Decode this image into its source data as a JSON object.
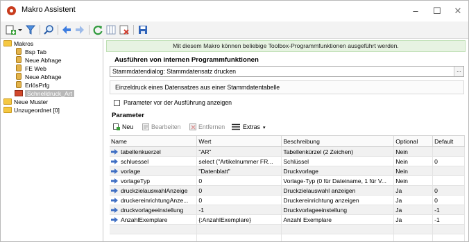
{
  "window": {
    "title": "Makro Assistent",
    "minimize": "–",
    "maximize": "☐",
    "close": "✕"
  },
  "toolbar": {
    "icons": [
      "add-icon",
      "funnel-icon",
      "search-icon",
      "back-icon",
      "forward-icon",
      "refresh-icon",
      "columns-icon",
      "delete-icon",
      "save-icon"
    ]
  },
  "tree": {
    "items": [
      {
        "label": "Makros",
        "type": "folder"
      },
      {
        "label": "Bsp Tab",
        "type": "doc"
      },
      {
        "label": "Neue Abfrage",
        "type": "doc"
      },
      {
        "label": "FE Web",
        "type": "doc"
      },
      {
        "label": "Neue Abfrage",
        "type": "doc"
      },
      {
        "label": "ErlösPrfg",
        "type": "doc"
      },
      {
        "label": "Schnelldruck_Art",
        "type": "macro"
      },
      {
        "label": "Neue Muster",
        "type": "folder"
      },
      {
        "label": "Unzugeordnet [0]",
        "type": "folder"
      }
    ]
  },
  "banner": "Mit diesem Makro können beliebige Toolbox-Programmfunktionen ausgeführt werden.",
  "section_exec": "Ausführen von internen Programmfunktionen",
  "function_combo": {
    "value": "Stammdatendialog: Stammdatensatz drucken",
    "button": "..."
  },
  "function_desc": "Einzeldruck eines Datensatzes aus einer Stammdatentabelle",
  "show_params_label": "Parameter vor der Ausführung anzeigen",
  "show_params_checked": false,
  "section_params": "Parameter",
  "grid_toolbar": {
    "new": "Neu",
    "edit": "Bearbeiten",
    "remove": "Entfernen",
    "extras": "Extras"
  },
  "grid": {
    "columns": [
      "Name",
      "Wert",
      "Beschreibung",
      "Optional",
      "Default"
    ],
    "rows": [
      {
        "name": "tabellenkuerzel",
        "wert": "\"AR\"",
        "beschreibung": "Tabellenkürzel (2 Zeichen)",
        "optional": "Nein",
        "default": ""
      },
      {
        "name": "schluessel",
        "wert": "select (\"Artikelnummer FR...",
        "beschreibung": "Schlüssel",
        "optional": "Nein",
        "default": "0"
      },
      {
        "name": "vorlage",
        "wert": "\"Datenblatt\"",
        "beschreibung": "Druckvorlage",
        "optional": "Nein",
        "default": ""
      },
      {
        "name": "vorlageTyp",
        "wert": "0",
        "beschreibung": "Vorlage-Typ (0 für Dateiname, 1 für V...",
        "optional": "Nein",
        "default": ""
      },
      {
        "name": "druckzielauswahlAnzeige",
        "wert": "0",
        "beschreibung": "Druckzielauswahl anzeigen",
        "optional": "Ja",
        "default": "0"
      },
      {
        "name": "druckereinrichtungAnze...",
        "wert": "0",
        "beschreibung": "Druckereinrichtung anzeigen",
        "optional": "Ja",
        "default": "0"
      },
      {
        "name": "druckvorlageeinstellung",
        "wert": "-1",
        "beschreibung": "Druckvorlageeinstellung",
        "optional": "Ja",
        "default": "-1"
      },
      {
        "name": "AnzahlExemplare",
        "wert": "{:AnzahlExemplare}",
        "beschreibung": "Anzahl Exemplare",
        "optional": "Ja",
        "default": "-1"
      }
    ]
  },
  "colors": {
    "banner_bg": "#e7f3e2",
    "row_arrow": "#3f6fc4",
    "selection": "#b8b8b8"
  }
}
